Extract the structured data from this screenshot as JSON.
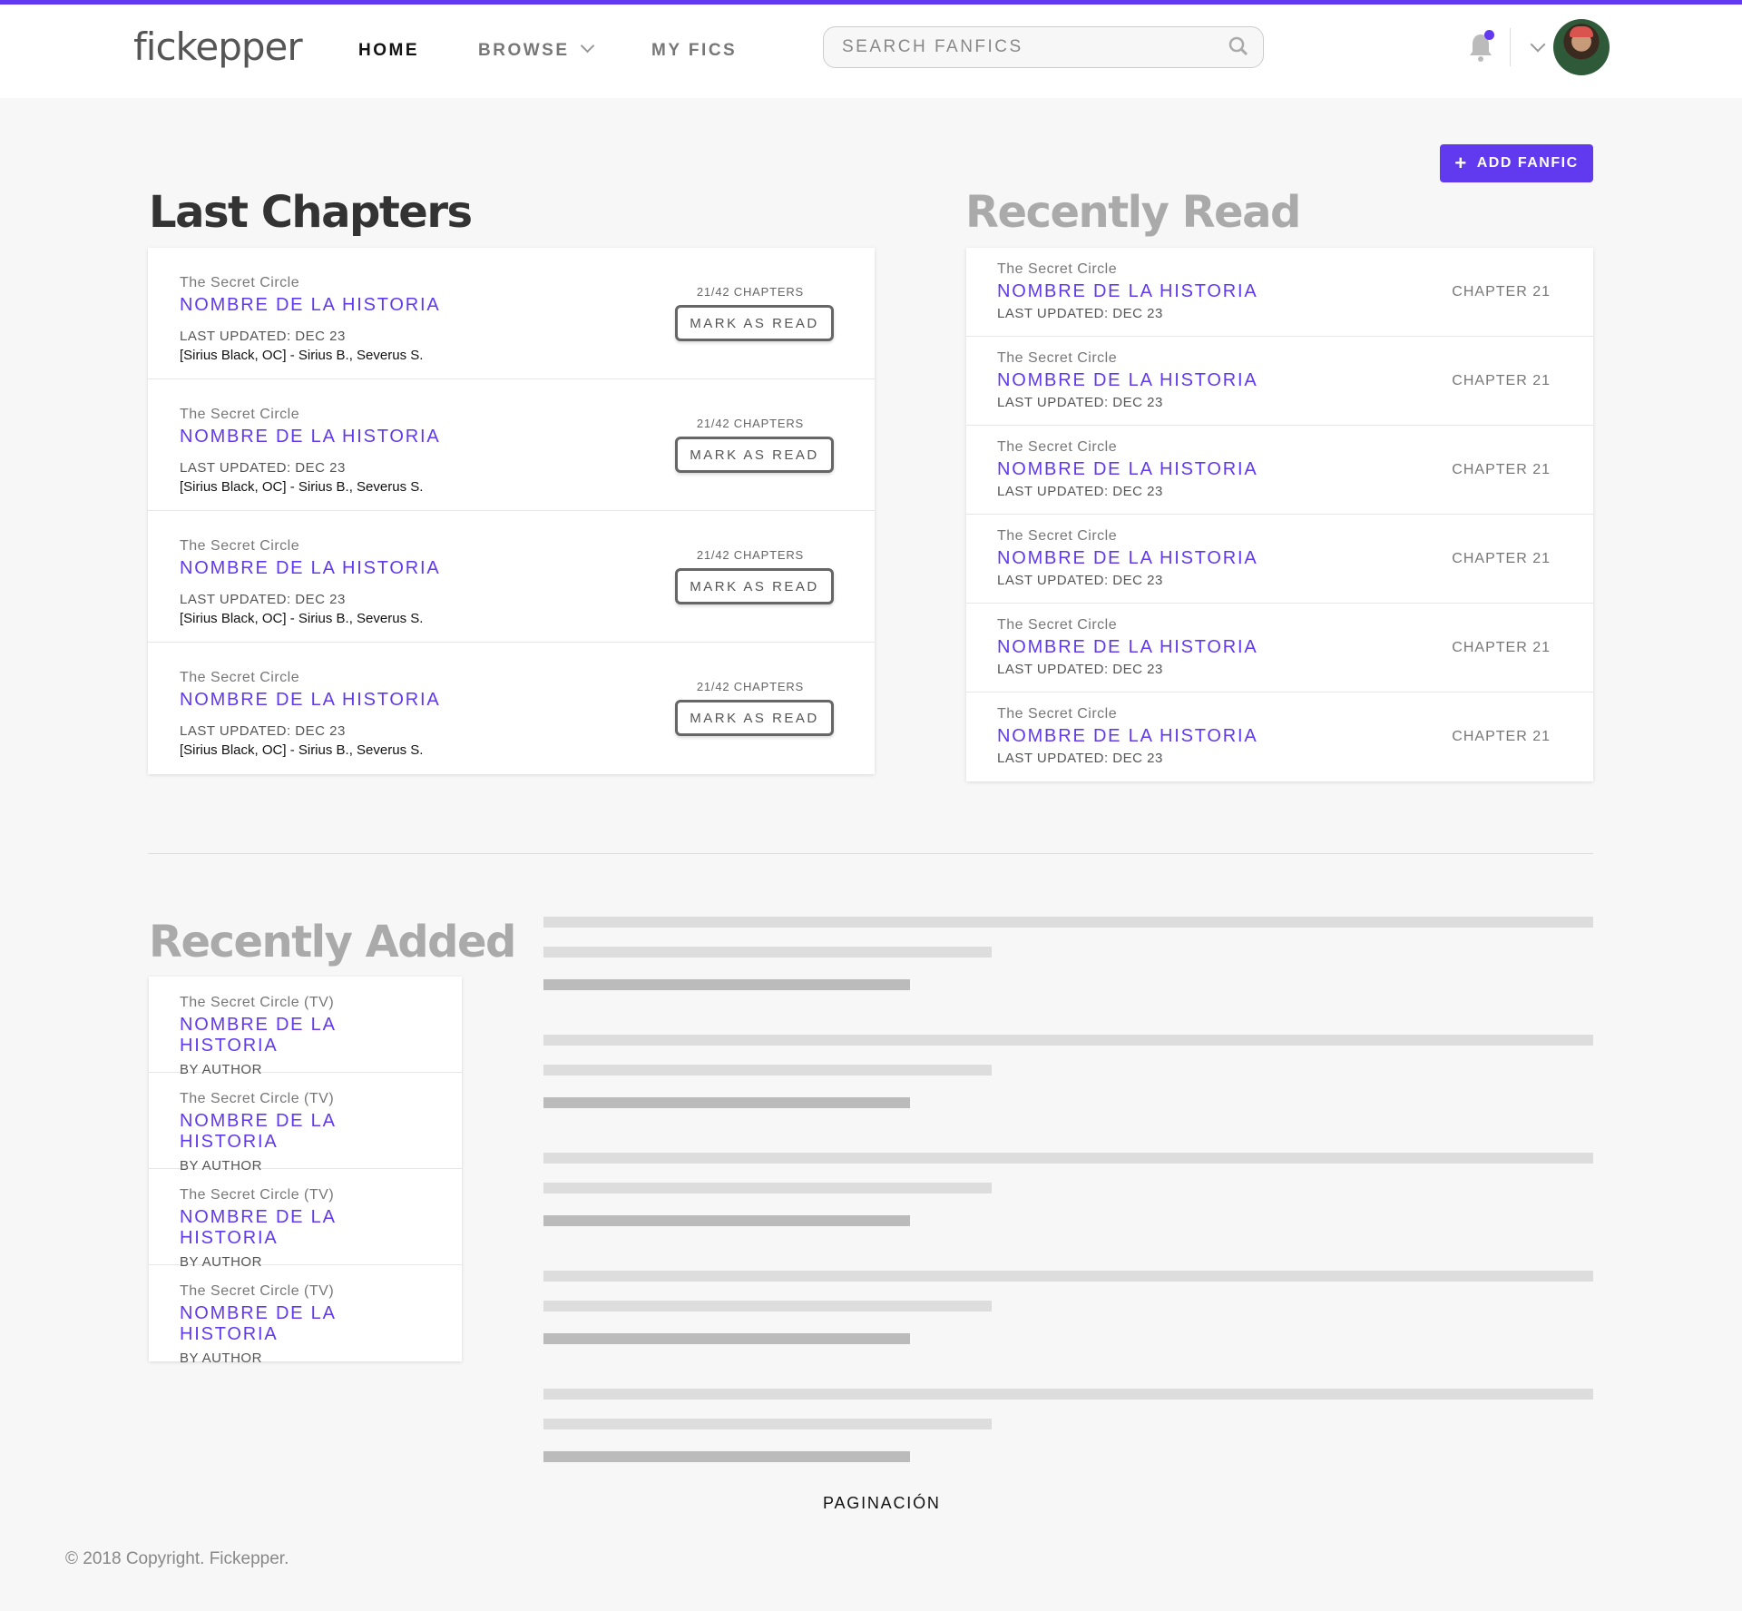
{
  "colors": {
    "accent": "#6139ee"
  },
  "header": {
    "logo": "fickepper",
    "nav": [
      {
        "label": "HOME",
        "active": true
      },
      {
        "label": "BROWSE"
      },
      {
        "label": "MY FICS"
      }
    ],
    "search_placeholder": "SEARCH FANFICS",
    "icons": [
      "search-icon",
      "bell-icon",
      "chevron-down-icon",
      "avatar"
    ]
  },
  "add_button": "ADD FANFIC",
  "last_chapters": {
    "title": "Last Chapters",
    "items": [
      {
        "fandom": "The Secret Circle",
        "title": "NOMBRE DE LA HISTORIA",
        "updated": "LAST UPDATED: DEC 23",
        "characters": "[Sirius Black, OC] - Sirius B., Severus S.",
        "progress": "21/42 CHAPTERS",
        "button": "MARK AS READ"
      },
      {
        "fandom": "The Secret Circle",
        "title": "NOMBRE DE LA HISTORIA",
        "updated": "LAST UPDATED: DEC 23",
        "characters": "[Sirius Black, OC] - Sirius B., Severus S.",
        "progress": "21/42 CHAPTERS",
        "button": "MARK AS READ"
      },
      {
        "fandom": "The Secret Circle",
        "title": "NOMBRE DE LA HISTORIA",
        "updated": "LAST UPDATED: DEC 23",
        "characters": "[Sirius Black, OC] - Sirius B., Severus S.",
        "progress": "21/42 CHAPTERS",
        "button": "MARK AS READ"
      },
      {
        "fandom": "The Secret Circle",
        "title": "NOMBRE DE LA HISTORIA",
        "updated": "LAST UPDATED: DEC 23",
        "characters": "[Sirius Black, OC] - Sirius B., Severus S.",
        "progress": "21/42 CHAPTERS",
        "button": "MARK AS READ"
      }
    ]
  },
  "recently_read": {
    "title": "Recently Read",
    "items": [
      {
        "fandom": "The Secret Circle",
        "title": "NOMBRE DE LA HISTORIA",
        "updated": "LAST UPDATED: DEC 23",
        "chapter": "CHAPTER 21"
      },
      {
        "fandom": "The Secret Circle",
        "title": "NOMBRE DE LA HISTORIA",
        "updated": "LAST UPDATED: DEC 23",
        "chapter": "CHAPTER 21"
      },
      {
        "fandom": "The Secret Circle",
        "title": "NOMBRE DE LA HISTORIA",
        "updated": "LAST UPDATED: DEC 23",
        "chapter": "CHAPTER 21"
      },
      {
        "fandom": "The Secret Circle",
        "title": "NOMBRE DE LA HISTORIA",
        "updated": "LAST UPDATED: DEC 23",
        "chapter": "CHAPTER 21"
      },
      {
        "fandom": "The Secret Circle",
        "title": "NOMBRE DE LA HISTORIA",
        "updated": "LAST UPDATED: DEC 23",
        "chapter": "CHAPTER 21"
      },
      {
        "fandom": "The Secret Circle",
        "title": "NOMBRE DE LA HISTORIA",
        "updated": "LAST UPDATED: DEC 23",
        "chapter": "CHAPTER 21"
      }
    ]
  },
  "recently_added": {
    "title": "Recently Added",
    "items": [
      {
        "fandom": "The Secret Circle (TV)",
        "title": "NOMBRE DE LA HISTORIA",
        "author": "BY AUTHOR"
      },
      {
        "fandom": "The Secret Circle (TV)",
        "title": "NOMBRE DE LA HISTORIA",
        "author": "BY AUTHOR"
      },
      {
        "fandom": "The Secret Circle (TV)",
        "title": "NOMBRE DE LA HISTORIA",
        "author": "BY AUTHOR"
      },
      {
        "fandom": "The Secret Circle (TV)",
        "title": "NOMBRE DE LA HISTORIA",
        "author": "BY AUTHOR"
      }
    ]
  },
  "pagination": "PAGINACIÓN",
  "footer": "© 2018 Copyright. Fickepper."
}
